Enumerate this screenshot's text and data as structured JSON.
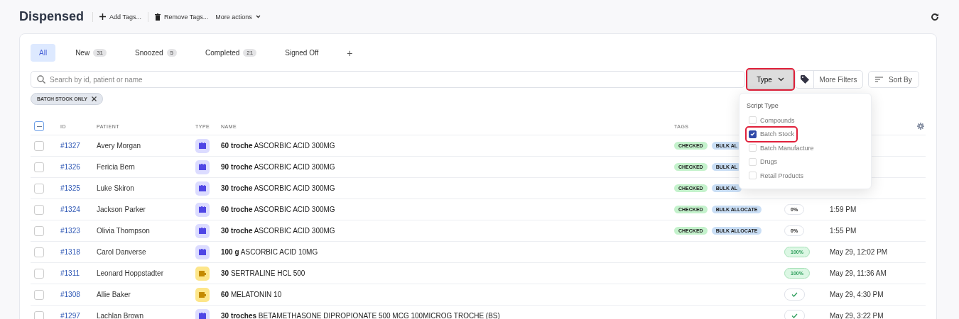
{
  "header": {
    "title": "Dispensed",
    "actions": [
      {
        "kind": "add",
        "label": "Add Tags..."
      },
      {
        "kind": "remove",
        "label": "Remove Tags..."
      },
      {
        "kind": "more",
        "label": "More actions"
      }
    ]
  },
  "tabs": [
    {
      "label": "All",
      "selected": true
    },
    {
      "label": "New",
      "count": "31",
      "selected": false
    },
    {
      "label": "Snoozed",
      "count": "5",
      "selected": false
    },
    {
      "label": "Completed",
      "count": "21",
      "selected": false
    },
    {
      "label": "Signed Off",
      "selected": false
    }
  ],
  "add_tab": "+",
  "search": {
    "placeholder": "Search by id, patient or name"
  },
  "filters": {
    "type": {
      "label": "Type",
      "highlighted": true
    },
    "more": "More Filters",
    "sort": "Sort By"
  },
  "active_filters": [
    {
      "label": "BATCH STOCK ONLY"
    }
  ],
  "table": {
    "header_checkbox": {
      "indeterminate": true
    },
    "columns": [
      "ID",
      "PATIENT",
      "TYPE",
      "NAME",
      "TAGS"
    ],
    "rows": [
      {
        "id": "#1327",
        "selected": false,
        "patient": "Avery Morgan",
        "kind": "compound",
        "name": "**60 troche** ASCORBIC ACID 300MG",
        "tags": [
          {
            "kind": "checked",
            "label": "CHECKED"
          },
          {
            "kind": "bulk",
            "label": "BULK AL"
          }
        ]
      },
      {
        "id": "#1326",
        "selected": false,
        "patient": "Fericia Bern",
        "kind": "compound",
        "name": "**90 troche** ASCORBIC ACID 300MG",
        "tags": [
          {
            "kind": "checked",
            "label": "CHECKED"
          },
          {
            "kind": "bulk",
            "label": "BULK AL"
          }
        ]
      },
      {
        "id": "#1325",
        "selected": false,
        "patient": "Luke Skiron",
        "kind": "compound",
        "name": "**30 troche** ASCORBIC ACID 300MG",
        "tags": [
          {
            "kind": "checked",
            "label": "CHECKED"
          },
          {
            "kind": "bulk",
            "label": "BULK AL"
          }
        ]
      },
      {
        "id": "#1324",
        "selected": false,
        "patient": "Jackson Parker",
        "kind": "compound",
        "name": "**60 troche** ASCORBIC ACID 300MG",
        "tags": [
          {
            "kind": "checked",
            "label": "CHECKED"
          },
          {
            "kind": "bulk",
            "label": "BULK ALLOCATE"
          }
        ],
        "progress": {
          "kind": "percent",
          "text": "0%"
        },
        "date": "1:59 PM"
      },
      {
        "id": "#1323",
        "selected": false,
        "patient": "Olivia Thompson",
        "kind": "compound",
        "name": "**30 troche** ASCORBIC ACID 300MG",
        "tags": [
          {
            "kind": "checked",
            "label": "CHECKED"
          },
          {
            "kind": "bulk",
            "label": "BULK ALLOCATE"
          }
        ],
        "progress": {
          "kind": "percent",
          "text": "0%"
        },
        "date": "1:55 PM"
      },
      {
        "id": "#1318",
        "selected": false,
        "patient": "Carol Danverse",
        "kind": "compound",
        "name": "**100 g** ASCORBIC ACID 10MG",
        "progress": {
          "kind": "complete",
          "text": "100%"
        },
        "date": "May 29, 12:02 PM"
      },
      {
        "id": "#1311",
        "selected": false,
        "patient": "Leonard Hoppstadter",
        "kind": "drug",
        "name": "**30** SERTRALINE HCL 500",
        "progress": {
          "kind": "complete",
          "text": "100%"
        },
        "date": "May 29, 11:36 AM"
      },
      {
        "id": "#1308",
        "selected": false,
        "patient": "Allie Baker",
        "kind": "drug",
        "name": "**60** MELATONIN 10",
        "progress": {
          "kind": "done"
        },
        "date": "May 29, 4:30 PM"
      },
      {
        "id": "#1297",
        "selected": false,
        "patient": "Lachlan Brown",
        "kind": "compound",
        "name": "**30 troches** BETAMETHASONE DIPROPIONATE 500 MCG 100MICROG TROCHE (BS)",
        "progress": {
          "kind": "done"
        },
        "date": "May 29, 3:22 PM"
      }
    ]
  },
  "type_menu": {
    "title": "Script Type",
    "options": [
      {
        "label": "Compounds",
        "checked": false,
        "highlighted": false
      },
      {
        "label": "Batch Stock",
        "checked": true,
        "highlighted": true
      },
      {
        "label": "Batch Manufacture",
        "checked": false,
        "highlighted": false
      },
      {
        "label": "Drugs",
        "checked": false,
        "highlighted": false
      },
      {
        "label": "Retail Products",
        "checked": false,
        "highlighted": false
      }
    ]
  }
}
